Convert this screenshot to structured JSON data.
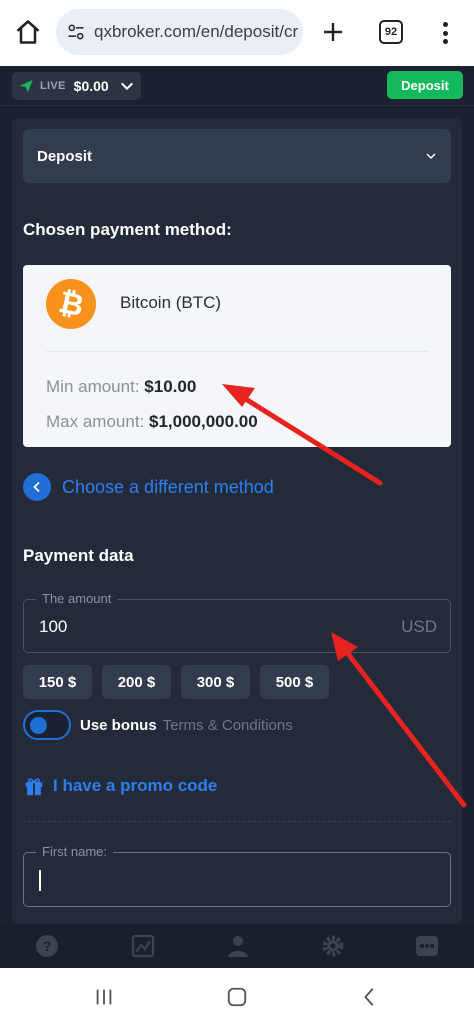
{
  "browser": {
    "url": "qxbroker.com/en/deposit/cr",
    "tab_count": "92"
  },
  "header": {
    "account_type": "LIVE",
    "balance": "$0.00",
    "deposit_button": "Deposit"
  },
  "deposit_section": {
    "label": "Deposit"
  },
  "payment_method": {
    "title": "Chosen payment method:",
    "name": "Bitcoin (BTC)",
    "min_label": "Min amount:",
    "min_value": "$10.00",
    "max_label": "Max amount:",
    "max_value": "$1,000,000.00",
    "change_link": "Choose a different method"
  },
  "payment_data": {
    "title": "Payment data",
    "amount_label": "The amount",
    "amount_value": "100",
    "currency": "USD",
    "quick_amounts": [
      "150 $",
      "200 $",
      "300 $",
      "500 $"
    ],
    "use_bonus_label": "Use bonus",
    "terms_link": "Terms & Conditions",
    "promo_link": "I have a promo code",
    "first_name_label": "First name:"
  },
  "icons": {
    "home": "home-icon",
    "site_settings": "tune-icon",
    "new_tab": "plus-icon",
    "menu": "more-vert-icon",
    "bottom_nav": [
      "help-icon",
      "chart-icon",
      "user-icon",
      "settings-icon",
      "chat-icon"
    ]
  },
  "colors": {
    "accent_green": "#14b95e",
    "accent_blue": "#2d7ef0",
    "bitcoin_orange": "#f7931a",
    "annotation_red": "#e8231f"
  }
}
